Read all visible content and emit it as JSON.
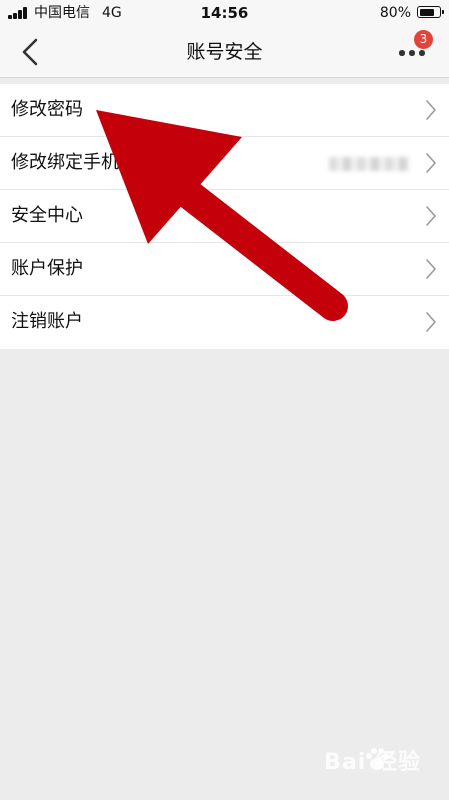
{
  "status_bar": {
    "carrier": "中国电信",
    "network": "4G",
    "time": "14:56",
    "battery": "80%",
    "battery_level": 0.8
  },
  "nav": {
    "title": "账号安全",
    "badge_count": "3",
    "back_icon": "chevron-left-icon",
    "more_icon": "more-icon"
  },
  "settings": {
    "items": [
      {
        "label": "修改密码",
        "icon": "chevron-right-icon"
      },
      {
        "label": "修改绑定手机",
        "icon": "chevron-right-icon"
      },
      {
        "label": "安全中心",
        "icon": "chevron-right-icon"
      },
      {
        "label": "账户保护",
        "icon": "chevron-right-icon"
      },
      {
        "label": "注销账户",
        "icon": "chevron-right-icon"
      }
    ]
  },
  "annotation": {
    "arrow_color": "#c4000b"
  },
  "watermark": {
    "text": "Bai 经验"
  },
  "colors": {
    "badge": "#e2433a",
    "background": "#ececec",
    "bar": "#f7f7f7"
  }
}
